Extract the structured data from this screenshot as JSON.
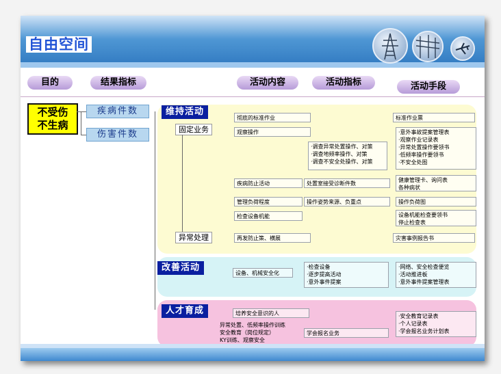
{
  "header": {
    "title": "自由空间"
  },
  "columns": [
    "目的",
    "结果指标",
    "活动内容",
    "活动指标",
    "活动手段"
  ],
  "goal": [
    "不受伤",
    "不生病"
  ],
  "results": [
    "疾病件数",
    "伤害件数"
  ],
  "sections": {
    "maintain": {
      "label": "维持活动",
      "fixed": "固定业务",
      "abnormal": "异常处理",
      "rows": [
        {
          "content": "彻底的标准作业",
          "indicator": "",
          "means": "标准作业票"
        },
        {
          "content": "观察操作",
          "indicator": "·调查异常处置操作、对策\n·调查地频率操作、对策\n·调查不安全处操作、对策",
          "means": "·意外事故提案管理表\n·观察作业记录表\n·异常处置操作要领书\n·低频率操作要领书\n·不安全处图"
        },
        {
          "content": "疾病防止活动",
          "indicator": "处置室接受诊断件数",
          "means": "健康管理卡、询问表\n各种病状"
        },
        {
          "content": "管理负荷程度",
          "indicator": "操作姿势来源、负重点",
          "means": "操作负荷图"
        },
        {
          "content": "检查设备机能",
          "indicator": "",
          "means": "设备机能检查要领书\n停止检查表"
        },
        {
          "content": "再发防止策、横展",
          "indicator": "",
          "means": "灾害事例报告书"
        }
      ]
    },
    "improve": {
      "label": "改善活动",
      "content": "设备、机械安全化",
      "indicator": "·检查设备\n·逐步提高活动\n·意外事件提案",
      "means": "·网络、安全检查便览\n·活动推进板\n·意外事件提案管理表"
    },
    "talent": {
      "label": "人才育成",
      "sub": "培养安全意识的人",
      "content": "异常处置、低频率操作训练\n安全教育（岗位规定）\nKY训练、观察安全",
      "indicator": "学会报名业务",
      "means": "·安全教育记录表\n·个人记录表\n·学会报名业务计划表"
    }
  }
}
